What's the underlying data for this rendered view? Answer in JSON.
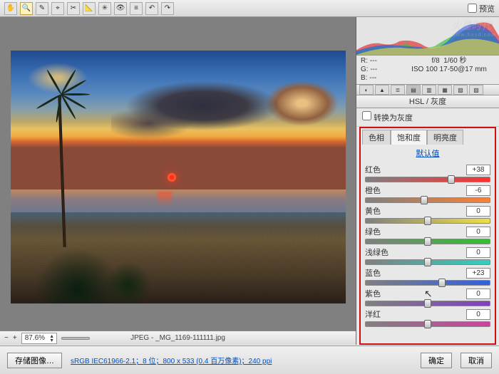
{
  "toolbar": {
    "preview_label": "预览"
  },
  "readout": {
    "r_label": "R:",
    "r_val": "---",
    "g_label": "G:",
    "g_val": "---",
    "b_label": "B:",
    "b_val": "---",
    "aperture": "f/8",
    "shutter": "1/60 秒",
    "iso_line": "ISO 100  17-50@17 mm"
  },
  "panel": {
    "title": "HSL / 灰度",
    "grayscale_label": "转换为灰度"
  },
  "tabs": {
    "hue": "色相",
    "sat": "饱和度",
    "lum": "明亮度"
  },
  "defaults_link": "默认值",
  "sliders": {
    "red": {
      "label": "红色",
      "value": "+38",
      "pos": 69
    },
    "orange": {
      "label": "橙色",
      "value": "-6",
      "pos": 47
    },
    "yellow": {
      "label": "黄色",
      "value": "0",
      "pos": 50
    },
    "green": {
      "label": "绿色",
      "value": "0",
      "pos": 50
    },
    "aqua": {
      "label": "浅绿色",
      "value": "0",
      "pos": 50
    },
    "blue": {
      "label": "蓝色",
      "value": "+23",
      "pos": 61.5
    },
    "purple": {
      "label": "紫色",
      "value": "0",
      "pos": 50
    },
    "magenta": {
      "label": "洋红",
      "value": "0",
      "pos": 50
    }
  },
  "canvas": {
    "zoom": "87.6%",
    "filename": "JPEG - _MG_1169-111111.jpg"
  },
  "footer": {
    "save_label": "存储图像…",
    "info": "sRGB IEC61966-2.1；8 位；800 x 533 (0.4 百万像素)；240 ppi",
    "ok": "确定",
    "cancel": "取消"
  },
  "watermark": {
    "brand": "火星时代",
    "url": "www.hxsd.com"
  }
}
